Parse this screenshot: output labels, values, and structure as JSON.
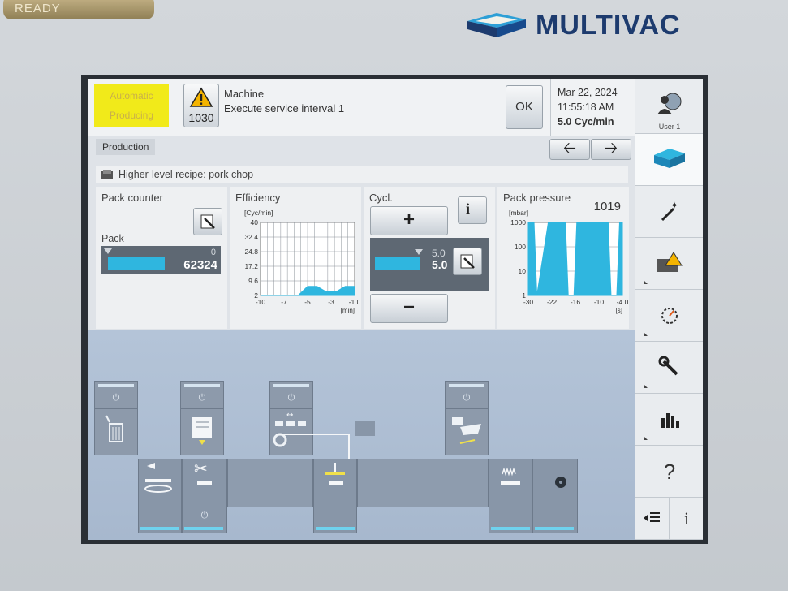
{
  "bezel": {
    "ready_label": "READY",
    "brand": "MULTIVAC"
  },
  "header": {
    "status_line1": "Automatic",
    "status_line2": "Producing",
    "message_code": "1030",
    "message_title": "Machine",
    "message_text": "Execute service interval 1",
    "ok_label": "OK",
    "date": "Mar 22, 2024",
    "time": "11:55:18 AM",
    "rate": "5.0 Cyc/min"
  },
  "tabs": {
    "current": "Production"
  },
  "recipe": {
    "label": "Higher-level recipe: pork chop"
  },
  "pack_counter": {
    "title": "Pack counter",
    "pack_label": "Pack",
    "target": "0",
    "count": "62324"
  },
  "efficiency": {
    "title": "Efficiency",
    "unit": "[Cyc/min]",
    "x_unit": "[min]"
  },
  "cycle": {
    "title": "Cycl.",
    "plus_label": "+",
    "minus_label": "−",
    "setpoint": "5.0",
    "actual": "5.0"
  },
  "pack_pressure": {
    "title": "Pack pressure",
    "value": "1019",
    "unit": "[mbar]",
    "x_unit": "[s]"
  },
  "sidebar": {
    "user_label": "User 1",
    "help_label": "?",
    "info_label": "i"
  },
  "chart_data": [
    {
      "type": "area",
      "title": "Efficiency",
      "ylabel": "[Cyc/min]",
      "xlabel": "[min]",
      "x_ticks": [
        "-10",
        "-7",
        "-5",
        "-3",
        "-1 0"
      ],
      "y_ticks": [
        "40",
        "32.4",
        "24.8",
        "17.2",
        "9.6",
        "2"
      ],
      "x": [
        -10,
        -8,
        -6,
        -5,
        -4,
        -3,
        -2,
        -1,
        0
      ],
      "values": [
        0,
        0,
        0,
        5,
        5,
        2,
        2,
        5,
        5
      ],
      "ylim": [
        0,
        40
      ],
      "color": "#2fb6df"
    },
    {
      "type": "area",
      "title": "Pack pressure",
      "ylabel": "[mbar]",
      "xlabel": "[s]",
      "scale": "log",
      "x_ticks": [
        "-30",
        "-22",
        "-16",
        "-10",
        "-4 0"
      ],
      "y_ticks": [
        "1000",
        "100",
        "10",
        "1"
      ],
      "x": [
        -33,
        -31,
        -30,
        -26,
        -25,
        -20,
        -19,
        -17,
        -16,
        -11,
        -10,
        -5,
        -4,
        -2,
        -1,
        0
      ],
      "values": [
        1000,
        1000,
        1,
        1000,
        1000,
        1000,
        1,
        1,
        1000,
        1000,
        1000,
        1000,
        1,
        1,
        1000,
        1000
      ],
      "ylim": [
        1,
        1000
      ],
      "color": "#2fb6df"
    }
  ]
}
